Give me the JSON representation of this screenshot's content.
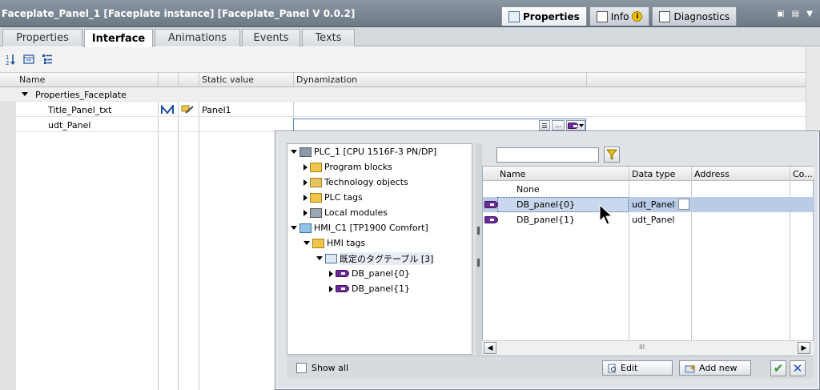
{
  "window": {
    "title": "Faceplate_Panel_1 [Faceplate instance] [Faceplate_Panel V 0.0.2]",
    "inspector_tabs": [
      {
        "label": "Properties",
        "icon": "properties-icon",
        "active": true
      },
      {
        "label": "Info",
        "icon": "info-icon",
        "active": false
      },
      {
        "label": "Diagnostics",
        "icon": "diagnostics-icon",
        "active": false
      }
    ],
    "info_badge": "i"
  },
  "tabs": [
    {
      "label": "Properties",
      "active": false
    },
    {
      "label": "Interface",
      "active": true
    },
    {
      "label": "Animations",
      "active": false
    },
    {
      "label": "Events",
      "active": false
    },
    {
      "label": "Texts",
      "active": false
    }
  ],
  "toolbar": {
    "icons": [
      "sort-icon",
      "collapse-icon",
      "expand-list-icon"
    ]
  },
  "grid": {
    "columns": {
      "name": "Name",
      "static_value": "Static value",
      "dynamization": "Dynamization"
    },
    "rows": [
      {
        "name": "Properties_Faceplate",
        "static_value": "",
        "group": true
      },
      {
        "name": "Title_Panel_txt",
        "static_value": "Panel1",
        "group": false
      },
      {
        "name": "udt_Panel",
        "static_value": "",
        "group": false
      }
    ],
    "dyn_more": "..."
  },
  "popup": {
    "tree": [
      {
        "label": "PLC_1 [CPU 1516F-3 PN/DP]",
        "level": 0,
        "expanded": true,
        "icon": "plc-icon"
      },
      {
        "label": "Program blocks",
        "level": 1,
        "expanded": false,
        "icon": "folder-icon"
      },
      {
        "label": "Technology objects",
        "level": 1,
        "expanded": false,
        "icon": "technology-icon"
      },
      {
        "label": "PLC tags",
        "level": 1,
        "expanded": false,
        "icon": "folder-icon"
      },
      {
        "label": "Local modules",
        "level": 1,
        "expanded": false,
        "icon": "modules-icon"
      },
      {
        "label": "HMI_C1 [TP1900 Comfort]",
        "level": 0,
        "expanded": true,
        "icon": "hmi-icon"
      },
      {
        "label": "HMI tags",
        "level": 1,
        "expanded": true,
        "icon": "folder-icon"
      },
      {
        "label": "既定のタグテーブル [3]",
        "level": 2,
        "expanded": true,
        "icon": "tag-table-icon"
      },
      {
        "label": "DB_panel{0}",
        "level": 3,
        "expanded": false,
        "icon": "tag-icon"
      },
      {
        "label": "DB_panel{1}",
        "level": 3,
        "expanded": false,
        "icon": "tag-icon"
      }
    ],
    "filter_value": "",
    "list_columns": {
      "name": "Name",
      "data_type": "Data type",
      "address": "Address",
      "comment": "Co..."
    },
    "list_rows": [
      {
        "name": "None",
        "data_type": "",
        "selected": false,
        "icon": false
      },
      {
        "name": "DB_panel{0}",
        "data_type": "udt_Panel",
        "selected": true,
        "icon": true
      },
      {
        "name": "DB_panel{1}",
        "data_type": "udt_Panel",
        "selected": false,
        "icon": true
      }
    ],
    "scroll_middle": "III",
    "show_all_label": "Show all",
    "edit_label": "Edit",
    "add_new_label": "Add new",
    "ok_glyph": "✔",
    "cancel_glyph": "✕"
  }
}
